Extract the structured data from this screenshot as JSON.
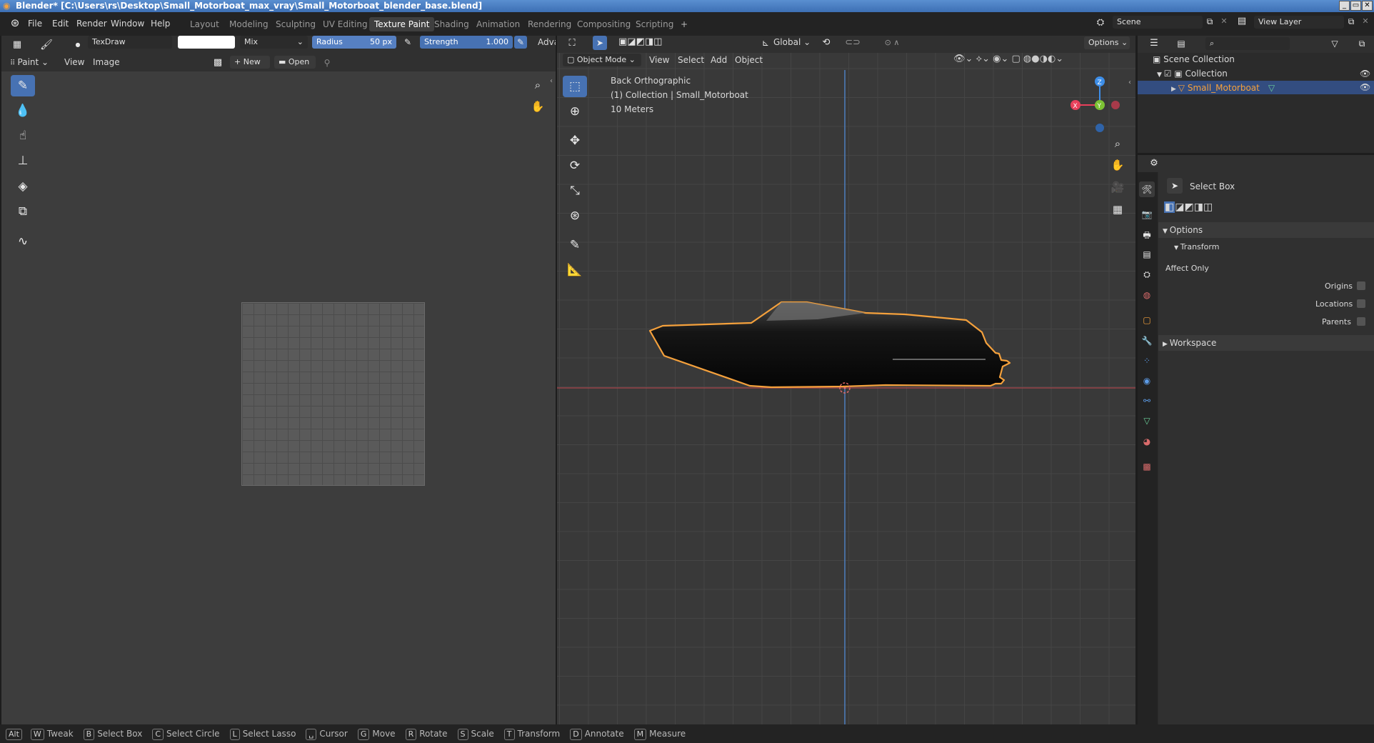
{
  "window": {
    "title": "Blender* [C:\\Users\\rs\\Desktop\\Small_Motorboat_max_vray\\Small_Motorboat_blender_base.blend]",
    "controls": [
      "_",
      "▭",
      "✕"
    ]
  },
  "menubar": {
    "items": [
      "File",
      "Edit",
      "Render",
      "Window",
      "Help"
    ],
    "workspaces": [
      "Layout",
      "Modeling",
      "Sculpting",
      "UV Editing",
      "Texture Paint",
      "Shading",
      "Animation",
      "Rendering",
      "Compositing",
      "Scripting"
    ],
    "active_workspace": "Texture Paint",
    "add_workspace": "+",
    "scene_label": "Scene",
    "view_layer_label": "View Layer"
  },
  "image_editor": {
    "brush_name": "TexDraw",
    "blend_mode": "Mix",
    "radius_label": "Radius",
    "radius_value": "50 px",
    "strength_label": "Strength",
    "strength_value": "1.000",
    "advanced_label": "Adva",
    "mode_label": "Paint",
    "menu_view": "View",
    "menu_image": "Image",
    "new_label": "New",
    "open_label": "Open",
    "icons": [
      "brush-icon",
      "drop-icon",
      "smear-icon",
      "stamp-icon",
      "fill-icon",
      "mask-icon",
      "annotate-icon"
    ]
  },
  "viewport": {
    "mode_label": "Object Mode",
    "menus": [
      "View",
      "Select",
      "Add",
      "Object"
    ],
    "transform_orientation": "Global",
    "options_label": "Options",
    "overlay_line1": "Back Orthographic",
    "overlay_line2": "(1) Collection | Small_Motorboat",
    "overlay_line3": "10 Meters",
    "gizmo_axes": {
      "x": "X",
      "y": "Y",
      "z": "Z"
    }
  },
  "outliner": {
    "scene_collection": "Scene Collection",
    "collection": "Collection",
    "object": "Small_Motorboat"
  },
  "properties": {
    "tool_name": "Select Box",
    "options_label": "Options",
    "transform_label": "Transform",
    "affect_only_label": "Affect Only",
    "origins_label": "Origins",
    "locations_label": "Locations",
    "parents_label": "Parents",
    "workspace_label": "Workspace"
  },
  "statusbar": {
    "items": [
      {
        "key": "Alt",
        "label": ""
      },
      {
        "key": "W",
        "label": "Tweak"
      },
      {
        "key": "B",
        "label": "Select Box"
      },
      {
        "key": "C",
        "label": "Select Circle"
      },
      {
        "key": "L",
        "label": "Select Lasso"
      },
      {
        "key": "␣",
        "label": "Cursor"
      },
      {
        "key": "G",
        "label": "Move"
      },
      {
        "key": "R",
        "label": "Rotate"
      },
      {
        "key": "S",
        "label": "Scale"
      },
      {
        "key": "T",
        "label": "Transform"
      },
      {
        "key": "D",
        "label": "Annotate"
      },
      {
        "key": "M",
        "label": "Measure"
      }
    ]
  },
  "colors": {
    "accent": "#4772b3",
    "selection_outline": "#f5a13c",
    "x_axis": "#e8405b",
    "y_axis": "#7cc234",
    "z_axis": "#3d8ee8"
  }
}
